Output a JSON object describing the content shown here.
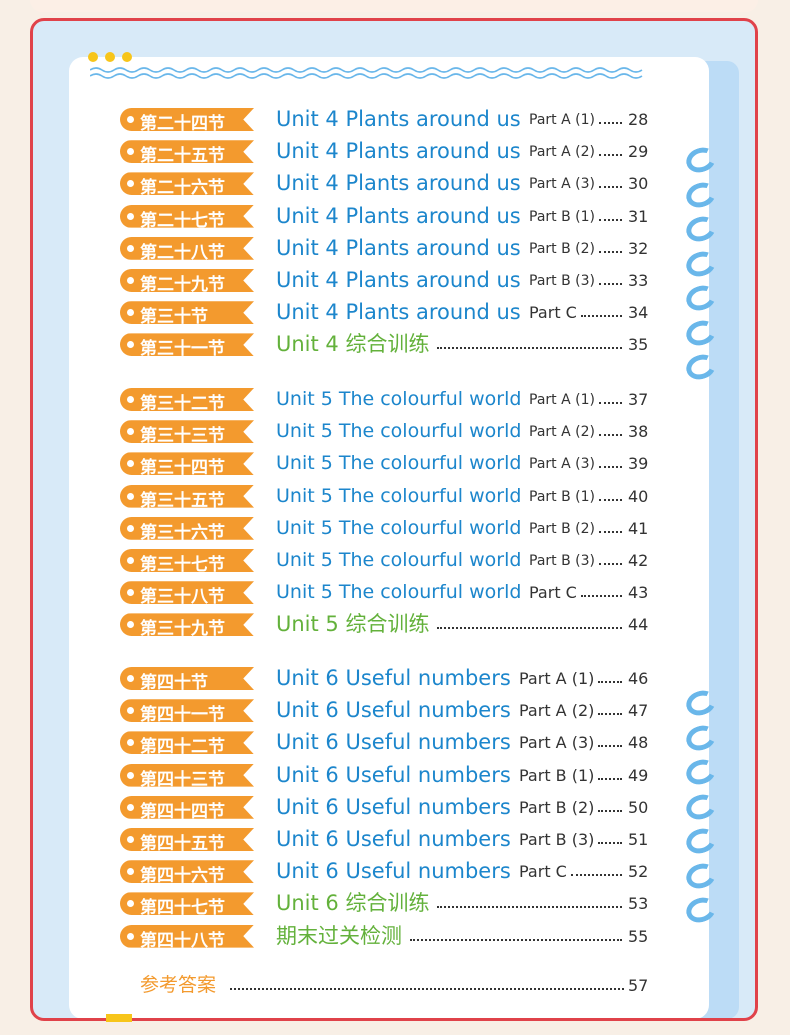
{
  "sections": [
    {
      "tag": "第二十四节",
      "title": "Unit 4 Plants around us",
      "part": "Part A (1)",
      "page": "28",
      "kind": "unit"
    },
    {
      "tag": "第二十五节",
      "title": "Unit 4 Plants around us",
      "part": "Part A (2)",
      "page": "29",
      "kind": "unit"
    },
    {
      "tag": "第二十六节",
      "title": "Unit 4 Plants around us",
      "part": "Part A (3)",
      "page": "30",
      "kind": "unit"
    },
    {
      "tag": "第二十七节",
      "title": "Unit 4 Plants around us",
      "part": "Part B (1)",
      "page": "31",
      "kind": "unit"
    },
    {
      "tag": "第二十八节",
      "title": "Unit 4 Plants around us",
      "part": "Part B (2)",
      "page": "32",
      "kind": "unit"
    },
    {
      "tag": "第二十九节",
      "title": "Unit 4 Plants around us",
      "part": "Part B (3)",
      "page": "33",
      "kind": "unit"
    },
    {
      "tag": "第三十节",
      "title": "Unit 4 Plants around us",
      "part": "Part C",
      "page": "34",
      "kind": "unit"
    },
    {
      "tag": "第三十一节",
      "title": "Unit 4 综合训练",
      "part": "",
      "page": "35",
      "kind": "review"
    },
    {
      "tag": "第三十二节",
      "title": "Unit 5 The colourful world",
      "part": "Part A (1)",
      "page": "37",
      "kind": "unit"
    },
    {
      "tag": "第三十三节",
      "title": "Unit 5 The colourful world",
      "part": "Part A (2)",
      "page": "38",
      "kind": "unit"
    },
    {
      "tag": "第三十四节",
      "title": "Unit 5 The colourful world",
      "part": "Part A (3)",
      "page": "39",
      "kind": "unit"
    },
    {
      "tag": "第三十五节",
      "title": "Unit 5 The colourful world",
      "part": "Part B (1)",
      "page": "40",
      "kind": "unit"
    },
    {
      "tag": "第三十六节",
      "title": "Unit 5 The colourful world",
      "part": "Part B (2)",
      "page": "41",
      "kind": "unit"
    },
    {
      "tag": "第三十七节",
      "title": "Unit 5 The colourful world",
      "part": "Part B (3)",
      "page": "42",
      "kind": "unit"
    },
    {
      "tag": "第三十八节",
      "title": "Unit 5 The colourful world",
      "part": "Part C",
      "page": "43",
      "kind": "unit"
    },
    {
      "tag": "第三十九节",
      "title": "Unit 5 综合训练",
      "part": "",
      "page": "44",
      "kind": "review"
    },
    {
      "tag": "第四十节",
      "title": "Unit 6 Useful numbers",
      "part": "Part A (1)",
      "page": "46",
      "kind": "unit"
    },
    {
      "tag": "第四十一节",
      "title": "Unit 6 Useful numbers",
      "part": "Part A (2)",
      "page": "47",
      "kind": "unit"
    },
    {
      "tag": "第四十二节",
      "title": "Unit 6 Useful numbers",
      "part": "Part A (3)",
      "page": "48",
      "kind": "unit"
    },
    {
      "tag": "第四十三节",
      "title": "Unit 6 Useful numbers",
      "part": "Part B (1)",
      "page": "49",
      "kind": "unit"
    },
    {
      "tag": "第四十四节",
      "title": "Unit 6 Useful numbers",
      "part": "Part B (2)",
      "page": "50",
      "kind": "unit"
    },
    {
      "tag": "第四十五节",
      "title": "Unit 6 Useful numbers",
      "part": "Part B (3)",
      "page": "51",
      "kind": "unit"
    },
    {
      "tag": "第四十六节",
      "title": "Unit 6 Useful numbers",
      "part": "Part C",
      "page": "52",
      "kind": "unit"
    },
    {
      "tag": "第四十七节",
      "title": "Unit 6 综合训练",
      "part": "",
      "page": "53",
      "kind": "review"
    },
    {
      "tag": "第四十八节",
      "title": "期末过关检测",
      "part": "",
      "page": "55",
      "kind": "review"
    }
  ],
  "answers": {
    "label": "参考答案",
    "page": "57"
  },
  "colors": {
    "tag": "#f39a2e",
    "unit_title": "#1c86cc",
    "review_title": "#63b13b",
    "frame": "#e0424a",
    "ring": "#6ab7ea"
  }
}
